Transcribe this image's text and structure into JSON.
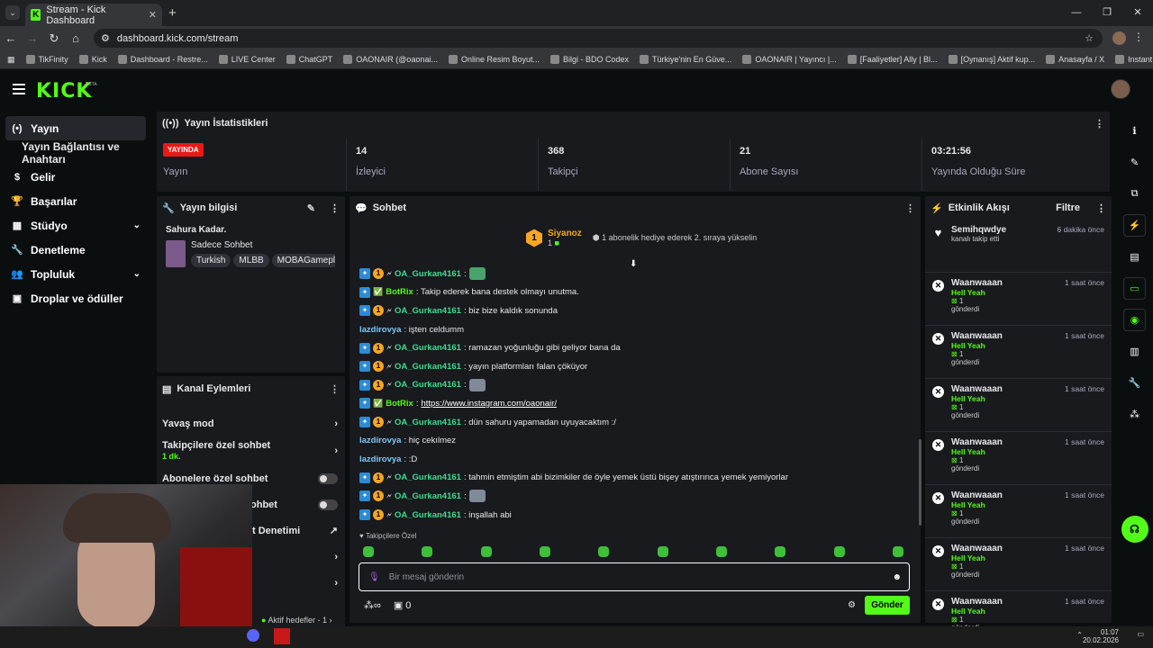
{
  "browser": {
    "tab_title": "Stream - Kick Dashboard",
    "url": "dashboard.kick.com/stream",
    "window_controls": [
      "—",
      "❐",
      "✕"
    ]
  },
  "bookmarks": [
    "TikFinity",
    "Kick",
    "Dashboard - Restre...",
    "LIVE Center",
    "ChatGPT",
    "OAONAIR (@oaonai...",
    "Online Resim Boyut...",
    "Bilgi - BDO Codex",
    "Türkiye'nin En Güve...",
    "OAONAIR | Yayıncı |...",
    "[Faaliyetler] Ally | Bl...",
    "[Oynanış] Aktif kup...",
    "Anasayfa / X",
    "Instant Background..."
  ],
  "logo": "KICK",
  "logo_badge": "BETA",
  "sidebar": {
    "items": [
      {
        "label": "Yayın",
        "icon": "(•)"
      },
      {
        "label": "Yayın Bağlantısı ve Anahtarı"
      },
      {
        "label": "Gelir",
        "icon": "$"
      },
      {
        "label": "Başarılar",
        "icon": "🏆"
      },
      {
        "label": "Stüdyo",
        "icon": "▦"
      },
      {
        "label": "Denetleme",
        "icon": "🔧"
      },
      {
        "label": "Topluluk",
        "icon": "👥"
      },
      {
        "label": "Droplar ve ödüller",
        "icon": "▣"
      }
    ]
  },
  "stats": {
    "title": "Yayın İstatistikleri",
    "live_badge": "YAYINDA",
    "live_label": "Yayın",
    "cells": [
      {
        "value": "14",
        "label": "İzleyici"
      },
      {
        "value": "368",
        "label": "Takipçi"
      },
      {
        "value": "21",
        "label": "Abone Sayısı"
      },
      {
        "value": "03:21:56",
        "label": "Yayında Olduğu Süre"
      }
    ]
  },
  "info": {
    "title": "Yayın bilgisi",
    "stream_title": "Sahura Kadar.",
    "category": "Sadece Sohbet",
    "tags": [
      "Turkish",
      "MLBB",
      "MOBAGamepla"
    ]
  },
  "kanal": {
    "title": "Kanal Eylemleri",
    "items": [
      {
        "label": "Yavaş mod",
        "type": "arrow"
      },
      {
        "label": "Takipçilere özel sohbet",
        "sub": "1 dk.",
        "type": "arrow"
      },
      {
        "label": "Abonelere özel sohbet",
        "type": "toggle"
      },
      {
        "label": "ohbet",
        "type": "toggle"
      },
      {
        "label": "t Denetimi",
        "type": "link"
      }
    ],
    "footer": "Aktif hedefler - 1"
  },
  "chat": {
    "title": "Sohbet",
    "pinned_user": "Siyanoz",
    "pinned_count": "1",
    "pinned_rank": "1",
    "gift_text": "1 abonelik hediye ederek 2. sıraya yükselin",
    "messages": [
      {
        "user": "OA_Gurkan4161",
        "badges": 3,
        "ucls": "u1",
        "text": ":",
        "emote": "g"
      },
      {
        "user": "BotRix",
        "badges": 2,
        "ucls": "u2",
        "text": ": Takip ederek bana destek olmayı unutma."
      },
      {
        "user": "OA_Gurkan4161",
        "badges": 3,
        "ucls": "u1",
        "text": ": biz bize kaldık sonunda"
      },
      {
        "user": "lazdirovya",
        "badges": 0,
        "ucls": "u3",
        "text": ": işten celdumm"
      },
      {
        "user": "OA_Gurkan4161",
        "badges": 3,
        "ucls": "u1",
        "text": ": ramazan yoğunluğu gibi geliyor bana da"
      },
      {
        "user": "OA_Gurkan4161",
        "badges": 3,
        "ucls": "u1",
        "text": ": yayın platformları falan çöküyor"
      },
      {
        "user": "OA_Gurkan4161",
        "badges": 3,
        "ucls": "u1",
        "text": ":",
        "emote": "c"
      },
      {
        "user": "BotRix",
        "badges": 2,
        "ucls": "u2",
        "text": ": ",
        "link": "https://www.instagram.com/oaonair/"
      },
      {
        "user": "OA_Gurkan4161",
        "badges": 3,
        "ucls": "u1",
        "text": ": dün sahuru yapamadan uyuyacaktım :/"
      },
      {
        "user": "lazdirovya",
        "badges": 0,
        "ucls": "u3",
        "text": ": hiç cekılmez"
      },
      {
        "user": "lazdirovya",
        "badges": 0,
        "ucls": "u3",
        "text": ": :D"
      },
      {
        "user": "OA_Gurkan4161",
        "badges": 3,
        "ucls": "u1",
        "text": ": tahmin etmiştim abi bizimkiler de öyle yemek üstü bişey atıştırınca yemek yemiyorlar"
      },
      {
        "user": "OA_Gurkan4161",
        "badges": 3,
        "ucls": "u1",
        "text": ":",
        "emote": "c"
      },
      {
        "user": "OA_Gurkan4161",
        "badges": 3,
        "ucls": "u1",
        "text": ": inşallah abi"
      }
    ],
    "followers_only": "Takipçilere Özel",
    "placeholder": "Bir mesaj gönderin",
    "points": "0",
    "send": "Gönder"
  },
  "events": {
    "title": "Etkinlik Akışı",
    "filter": "Filtre",
    "items": [
      {
        "name": "Semihqwdye",
        "time": "6 dakika önce",
        "line": "kanalı takip etti",
        "type": "follow"
      },
      {
        "name": "Waanwaaan",
        "time": "1 saat önce",
        "tag": "Hell Yeah",
        "count": "1",
        "line": "gönderdi"
      },
      {
        "name": "Waanwaaan",
        "time": "1 saat önce",
        "tag": "Hell Yeah",
        "count": "1",
        "line": "gönderdi"
      },
      {
        "name": "Waanwaaan",
        "time": "1 saat önce",
        "tag": "Hell Yeah",
        "count": "1",
        "line": "gönderdi"
      },
      {
        "name": "Waanwaaan",
        "time": "1 saat önce",
        "tag": "Hell Yeah",
        "count": "1",
        "line": "gönderdi"
      },
      {
        "name": "Waanwaaan",
        "time": "1 saat önce",
        "tag": "Hell Yeah",
        "count": "1",
        "line": "gönderdi"
      },
      {
        "name": "Waanwaaan",
        "time": "1 saat önce",
        "tag": "Hell Yeah",
        "count": "1",
        "line": "gönderdi"
      },
      {
        "name": "Waanwaaan",
        "time": "1 saat önce",
        "tag": "Hell Yeah",
        "count": "1",
        "line": "gönderdi"
      }
    ]
  },
  "taskbar": {
    "time": "01:07",
    "date": "20.02.2026"
  }
}
